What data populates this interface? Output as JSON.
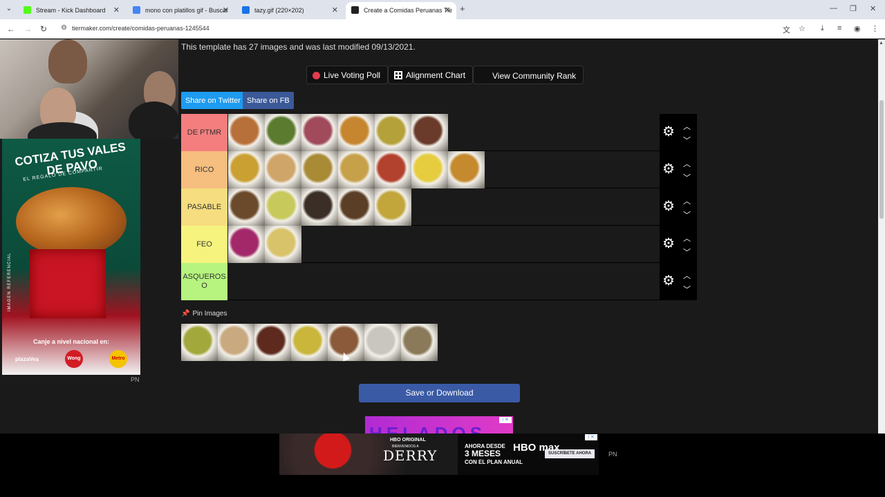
{
  "browser": {
    "tabs": [
      {
        "title": "Stream - Kick Dashboard",
        "fav": "#53fc18",
        "active": false
      },
      {
        "title": "mono con platillos gif - Buscar",
        "fav": "#4285f4",
        "active": false
      },
      {
        "title": "tazy.gif (220×202)",
        "fav": "#1a73e8",
        "active": false
      },
      {
        "title": "Create a Comidas Peruanas Tie",
        "fav": "#222222",
        "active": true
      }
    ],
    "url": "tiermaker.com/create/comidas-peruanas-1245544"
  },
  "page": {
    "info": "This template has 27 images and was last modified 09/13/2021.",
    "buttons": {
      "live_voting": "Live Voting Poll",
      "alignment": "Alignment Chart",
      "community": "View Community Rank"
    },
    "share": {
      "twitter": "Share on Twitter",
      "fb": "Share on FB"
    },
    "tiers": [
      {
        "label": "DE PTMR",
        "color": "#f47e7e",
        "items": [
          "#b8703a",
          "#5b7b2f",
          "#a04a5c",
          "#c6862f",
          "#b5a13a",
          "#6a3a2a"
        ]
      },
      {
        "label": "RICO",
        "color": "#f6be7f",
        "items": [
          "#caa033",
          "#d0a56a",
          "#a98a35",
          "#c6a14a",
          "#b2412d",
          "#e6cd3f",
          "#c58a2e"
        ]
      },
      {
        "label": "PASABLE",
        "color": "#f6dd7f",
        "items": [
          "#6b4a2b",
          "#c7c95a",
          "#3a2e26",
          "#5a3e26",
          "#c2a63c"
        ]
      },
      {
        "label": "FEO",
        "color": "#f6f47f",
        "items": [
          "#a3286a",
          "#d9c36a"
        ]
      },
      {
        "label": "ASQUEROS O",
        "color": "#b6f47f",
        "items": []
      }
    ],
    "pin_title": "Pin Images",
    "pin_items": [
      "#a2a83b",
      "#c9a980",
      "#5e2a1e",
      "#c9b63a",
      "#8a5a3a",
      "#c9c6c0",
      "#8a7a5a"
    ],
    "save": "Save or Download"
  },
  "ads": {
    "left": {
      "title": "COTIZA TUS VALES DE PAVO",
      "subtitle": "EL REGALO DE COMPARTIR",
      "footer": "Canje a nivel nacional en:",
      "side": "IMAGEN REFERENCIAL",
      "brands": [
        "plazaVea",
        "Wong",
        "Metro"
      ]
    },
    "middle": {
      "text": "HELADOS",
      "adx": "i ✕"
    },
    "bottom": {
      "hbo": "HBO ORIGINAL",
      "welcome": "BIENVENIDOS A",
      "movie": "DERRY",
      "promo1": "AHORA DESDE",
      "promo2": "3 MESES",
      "promo3": "CON EL PLAN ANUAL",
      "hbomax": "HBO max",
      "cta": "SUSCRÍBETE AHORA",
      "adx": "i ✕"
    },
    "pn": "PN"
  }
}
